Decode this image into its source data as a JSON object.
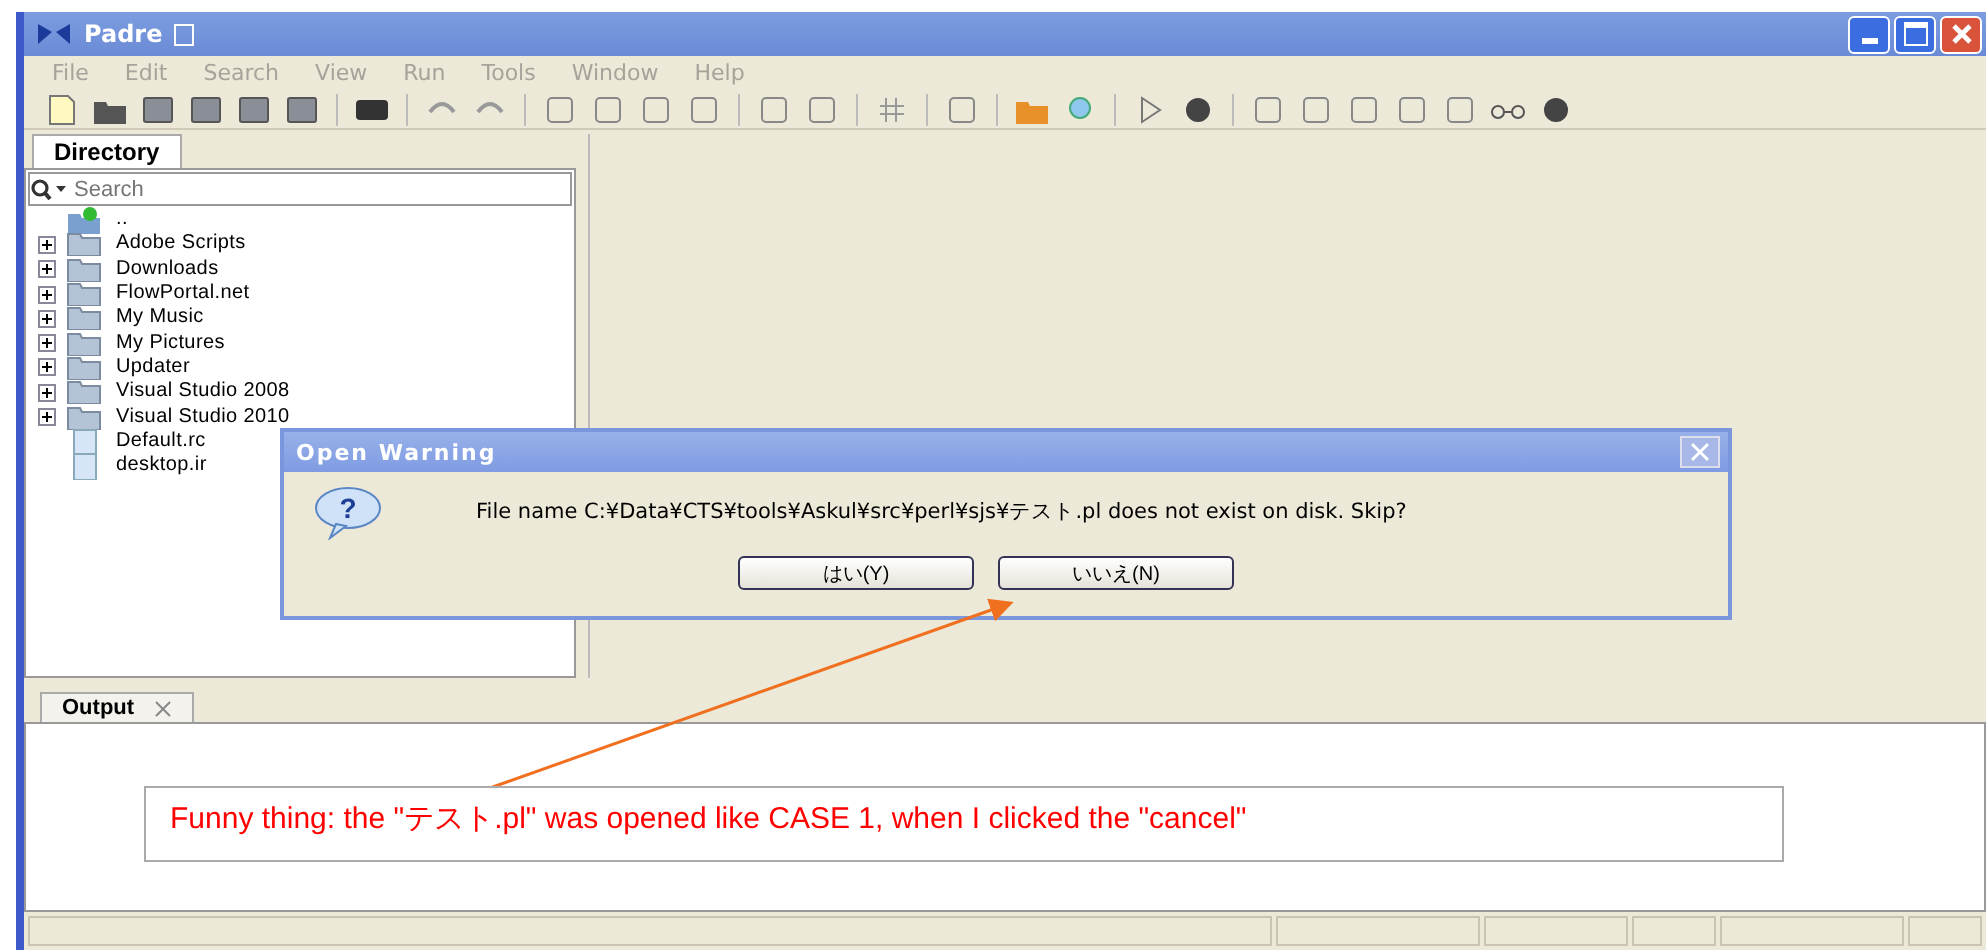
{
  "window": {
    "title": "Padre"
  },
  "menu": [
    "File",
    "Edit",
    "Search",
    "View",
    "Run",
    "Tools",
    "Window",
    "Help"
  ],
  "directory_panel": {
    "tab": "Directory",
    "search": {
      "placeholder": "Search"
    },
    "tree": [
      {
        "kind": "parent",
        "label": ".."
      },
      {
        "kind": "folder",
        "label": "Adobe Scripts",
        "expanded": false
      },
      {
        "kind": "folder",
        "label": "Downloads",
        "expanded": false
      },
      {
        "kind": "folder",
        "label": "FlowPortal.net",
        "expanded": false
      },
      {
        "kind": "folder",
        "label": "My Music",
        "expanded": false
      },
      {
        "kind": "folder",
        "label": "My Pictures",
        "expanded": false
      },
      {
        "kind": "folder",
        "label": "Updater",
        "expanded": false
      },
      {
        "kind": "folder",
        "label": "Visual Studio 2008",
        "expanded": false
      },
      {
        "kind": "folder",
        "label": "Visual Studio 2010",
        "expanded": false
      },
      {
        "kind": "file",
        "label": "Default.rc"
      },
      {
        "kind": "file",
        "label": "desktop.ir"
      }
    ]
  },
  "output_panel": {
    "tab": "Output"
  },
  "dialog": {
    "title": "Open Warning",
    "icon": "?",
    "message": "File name C:¥Data¥CTS¥tools¥Askul¥src¥perl¥sjs¥テスト.pl does not exist on disk. Skip?",
    "buttons": [
      "はい(Y)",
      "いいえ(N)"
    ]
  },
  "annotation": {
    "text": "Funny thing: the \"テスト.pl\" was opened like CASE 1, when I clicked the \"cancel\""
  }
}
